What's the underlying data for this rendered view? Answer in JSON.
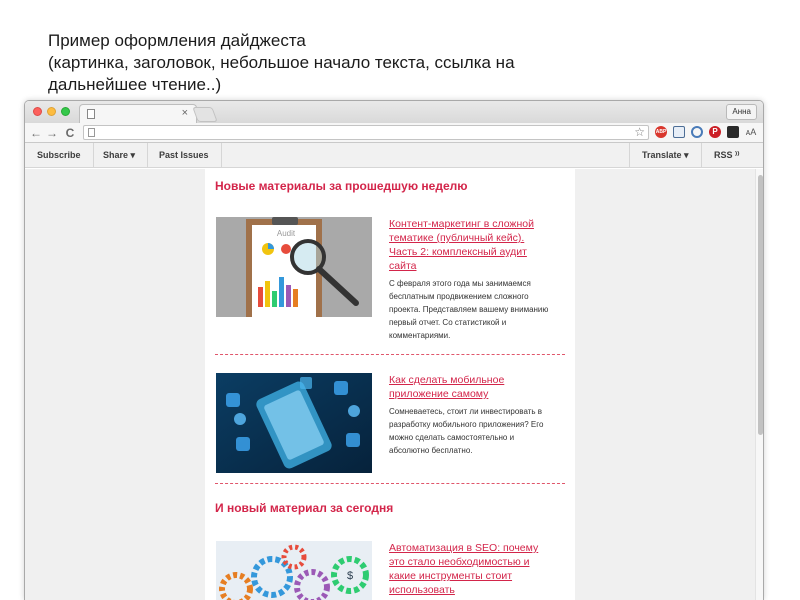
{
  "caption": {
    "line1": "Пример оформления дайджеста",
    "line2": "(картинка, заголовок, небольшое начало текста, ссылка на",
    "line3": "дальнейшее чтение..)"
  },
  "browser": {
    "tab_close": "×",
    "user_button": "Анна",
    "nav": {
      "back": "←",
      "forward": "→",
      "reload": "C"
    },
    "star": "☆",
    "extensions": {
      "abp": "ABP",
      "pinterest": "P",
      "text_size": "ᴀA",
      "menu": "≡"
    }
  },
  "mailchimp_bar": {
    "subscribe": "Subscribe",
    "share": "Share ▾",
    "past_issues": "Past Issues",
    "translate": "Translate ▾",
    "rss": "RSS ⁾⁾"
  },
  "email": {
    "section1_title": "Новые материалы за прошедшую неделю",
    "section2_title": "И новый материал за сегодня",
    "articles": [
      {
        "title_lines": [
          "Контент-маркетинг в сложной",
          "тематике (публичный кейс).",
          "Часть 2: комплексный аудит",
          "сайта"
        ],
        "image_label": "Audit",
        "text_lines": [
          "С февраля этого года мы занимаемся",
          "бесплатным продвижением сложного",
          "проекта. Представляем вашему вниманию",
          "первый отчет. Со статистикой и",
          "комментариями."
        ]
      },
      {
        "title_lines": [
          "Как сделать мобильное",
          "приложение самому"
        ],
        "text_lines": [
          "Сомневаетесь, стоит ли инвестировать в",
          "разработку мобильного приложения? Его",
          "можно сделать самостоятельно и",
          "абсолютно бесплатно."
        ]
      },
      {
        "title_lines": [
          "Автоматизация в SEO: почему",
          "это стало необходимостью и",
          "какие инструменты стоит",
          "использовать"
        ],
        "image_label": "$"
      }
    ]
  },
  "colors": {
    "accent": "#d3254a",
    "divider": "#e0566b",
    "page_bg": "#f0f0f0"
  }
}
